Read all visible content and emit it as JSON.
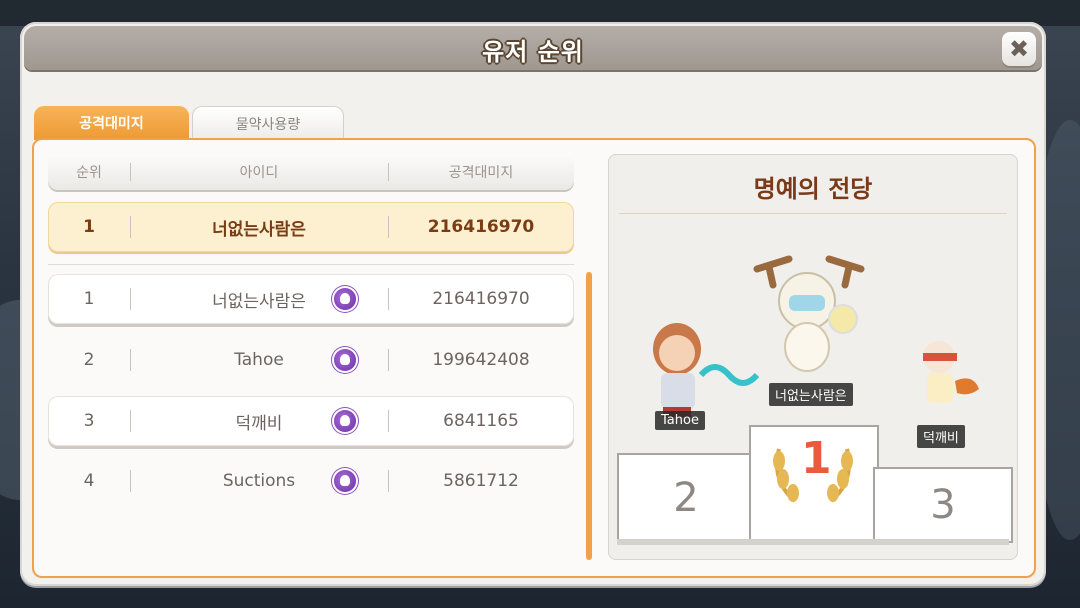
{
  "window": {
    "title": "유저 순위",
    "close_icon": "✖"
  },
  "tabs": [
    {
      "label": "공격대미지",
      "active": true
    },
    {
      "label": "물약사용량",
      "active": false
    }
  ],
  "table": {
    "headers": {
      "rank": "순위",
      "id": "아이디",
      "damage": "공격대미지"
    },
    "my_row": {
      "rank": "1",
      "id": "너없는사람은",
      "damage": "216416970"
    },
    "rows": [
      {
        "rank": "1",
        "id": "너없는사람은",
        "damage": "216416970"
      },
      {
        "rank": "2",
        "id": "Tahoe",
        "damage": "199642408"
      },
      {
        "rank": "3",
        "id": "덕깨비",
        "damage": "6841165"
      },
      {
        "rank": "4",
        "id": "Suctions",
        "damage": "5861712"
      }
    ]
  },
  "hall_of_fame": {
    "title": "명예의 전당",
    "first": {
      "name": "너없는사람은",
      "place": "1"
    },
    "second": {
      "name": "Tahoe",
      "place": "2"
    },
    "third": {
      "name": "덕깨비",
      "place": "3"
    }
  },
  "colors": {
    "accent": "#f0a14b",
    "highlight_row": "#fdf0d0",
    "title_text": "#7a3a18"
  }
}
